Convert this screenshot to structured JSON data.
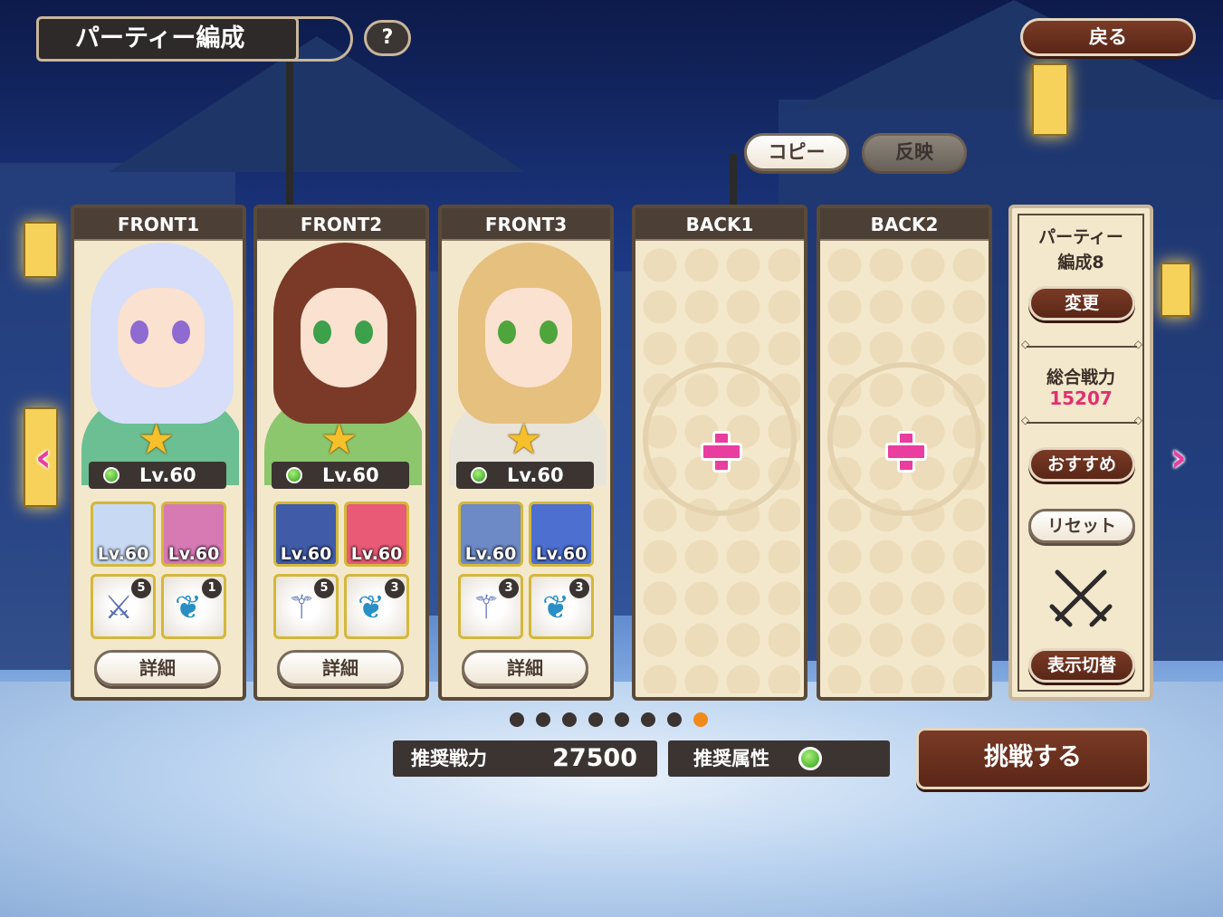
{
  "header": {
    "title": "パーティー編成",
    "help_label": "?",
    "back_label": "戻る"
  },
  "actions": {
    "copy_label": "コピー",
    "reflect_label": "反映"
  },
  "slots": [
    {
      "label": "FRONT1",
      "level": "Lv.60",
      "hair_color": "#d6defa",
      "body_color": "#6bbf93",
      "eye_color": "#8f6ad0",
      "subs": [
        {
          "level": "Lv.60",
          "bg": "#c7d9f3"
        },
        {
          "level": "Lv.60",
          "bg": "#d77ab4"
        }
      ],
      "equips": [
        {
          "count": "5",
          "glyph": "⚔"
        },
        {
          "count": "1",
          "glyph": "❦"
        }
      ],
      "detail_label": "詳細"
    },
    {
      "label": "FRONT2",
      "level": "Lv.60",
      "hair_color": "#7a3a27",
      "body_color": "#8cc66d",
      "eye_color": "#3da04a",
      "subs": [
        {
          "level": "Lv.60",
          "bg": "#405ba8"
        },
        {
          "level": "Lv.60",
          "bg": "#e85a76"
        }
      ],
      "equips": [
        {
          "count": "5",
          "glyph": "⚚"
        },
        {
          "count": "3",
          "glyph": "❦"
        }
      ],
      "detail_label": "詳細"
    },
    {
      "label": "FRONT3",
      "level": "Lv.60",
      "hair_color": "#e5c07f",
      "body_color": "#e9e4d9",
      "eye_color": "#4ea53c",
      "subs": [
        {
          "level": "Lv.60",
          "bg": "#6d8ac6"
        },
        {
          "level": "Lv.60",
          "bg": "#4c6fd0"
        }
      ],
      "equips": [
        {
          "count": "3",
          "glyph": "⚚"
        },
        {
          "count": "3",
          "glyph": "❦"
        }
      ],
      "detail_label": "詳細"
    }
  ],
  "empty_slots": [
    {
      "label": "BACK1"
    },
    {
      "label": "BACK2"
    }
  ],
  "info": {
    "party_name_line1": "パーティー",
    "party_name_line2": "編成8",
    "change_label": "変更",
    "power_label": "総合戦力",
    "power_value": "15207",
    "recommend_label": "おすすめ",
    "reset_label": "リセット",
    "switch_label": "表示切替"
  },
  "pagination": {
    "total": 8,
    "current": 8
  },
  "footer": {
    "rec_power_label": "推奨戦力",
    "rec_power_value": "27500",
    "rec_attr_label": "推奨属性",
    "challenge_label": "挑戦する"
  }
}
